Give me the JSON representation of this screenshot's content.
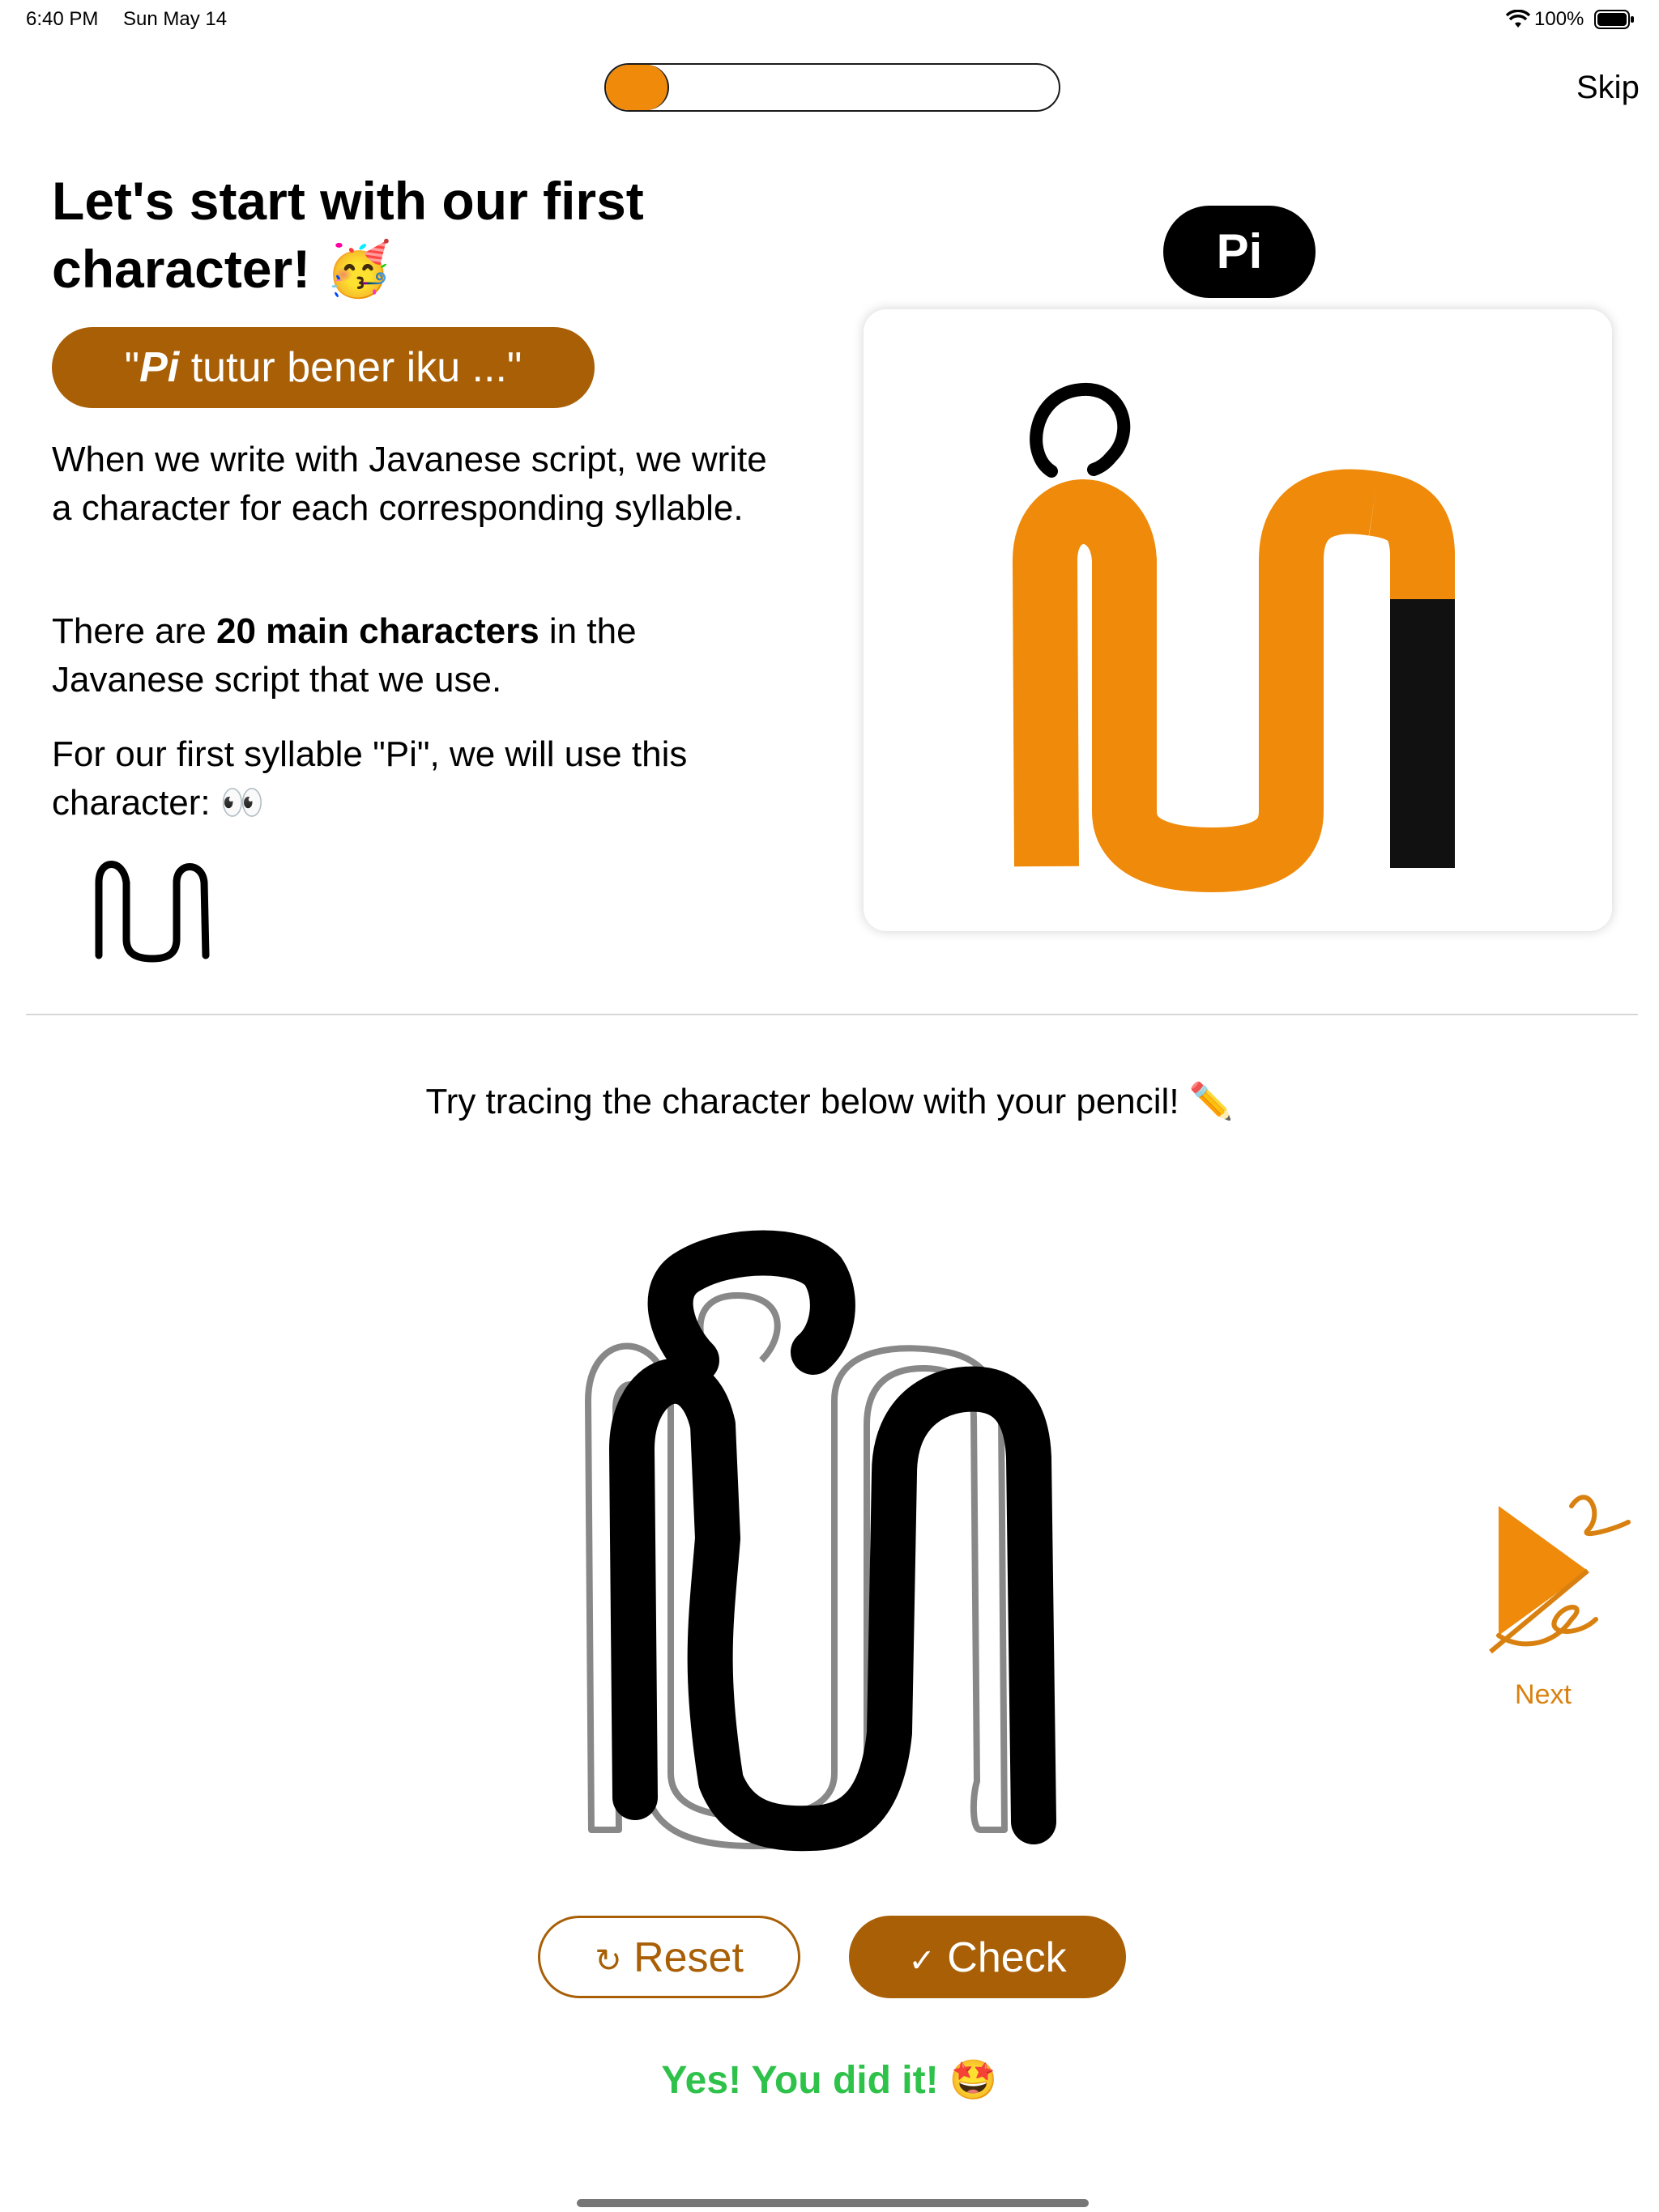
{
  "status_bar": {
    "time": "6:40 PM",
    "date": "Sun May 14",
    "battery": "100%"
  },
  "progress": {
    "fraction": 0.14
  },
  "header": {
    "skip_label": "Skip"
  },
  "intro": {
    "title": "Let's start with our first character! 🥳",
    "quote_prefix": "\"",
    "quote_emph": "Pi",
    "quote_rest": " tutur bener iku ...\"",
    "para1": "When we write with Javanese script, we write a character for each corresponding syllable.",
    "para2_a": "There are ",
    "para2_bold": "20 main characters",
    "para2_b": " in the Javanese script that we use.",
    "para3": "For our first syllable \"Pi\", we will use this character: 👀"
  },
  "stroke_card": {
    "syllable": "Pi"
  },
  "tracing": {
    "instruction": "Try tracing the character below with your pencil! ✏️",
    "reset_label": "Reset",
    "check_label": "Check",
    "reset_icon": "rotate-icon",
    "check_icon": "checkmark-icon",
    "success_message": "Yes! You did it! 🤩"
  },
  "navigation": {
    "next_label": "Next",
    "next_icon": "play-arrow-icon"
  },
  "colors": {
    "accent": "#a85f06",
    "orange": "#ef8a0a",
    "success": "#2fc24a"
  }
}
